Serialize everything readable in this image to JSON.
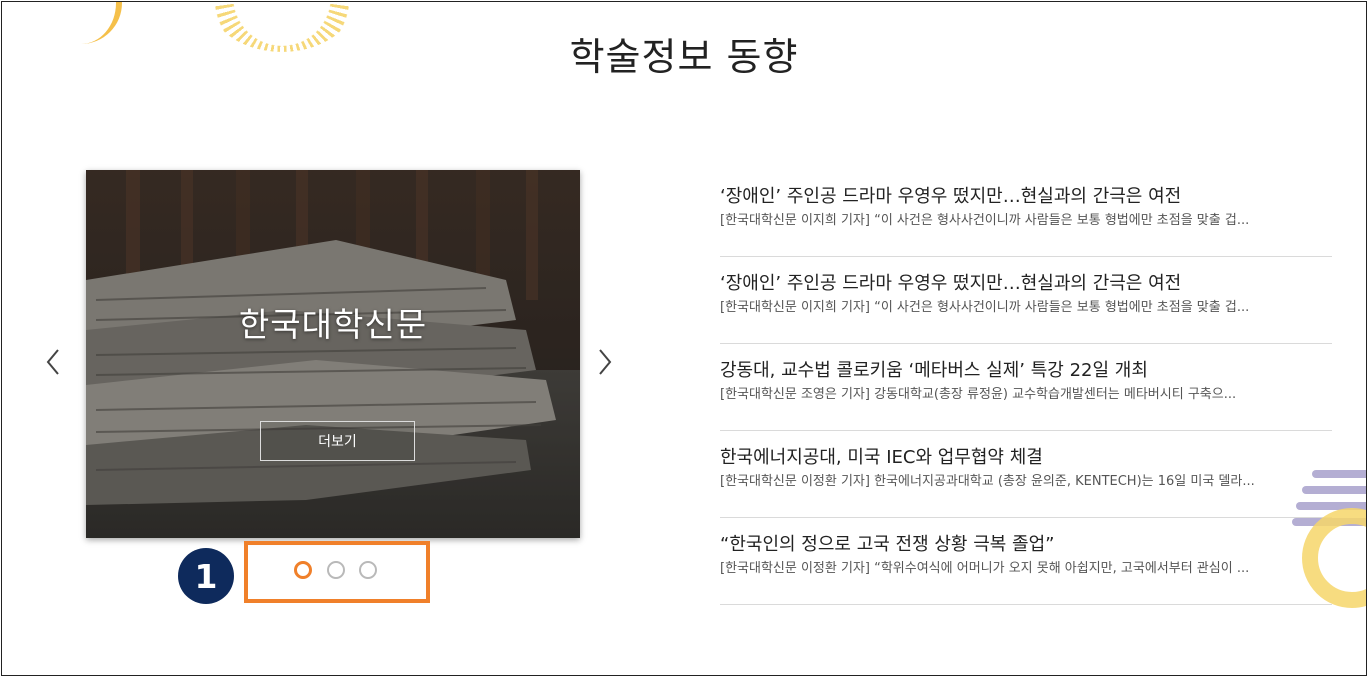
{
  "page": {
    "title": "학술정보 동향"
  },
  "slider": {
    "slide_title": "한국대학신문",
    "more_label": "더보기",
    "prev_icon": "chevron-left-icon",
    "next_icon": "chevron-right-icon",
    "dots": [
      {
        "active": true
      },
      {
        "active": false
      },
      {
        "active": false
      }
    ],
    "active_index": 0
  },
  "annotation": {
    "step_number": "1",
    "highlight_color": "#f0802a",
    "badge_color": "#0e2a5c"
  },
  "news": [
    {
      "title": "‘장애인’ 주인공 드라마 우영우 떴지만…현실과의 간극은 여전",
      "desc": "[한국대학신문 이지희 기자] “이 사건은 형사사건이니까 사람들은 보통 형법에만 초점을 맞출 겁..."
    },
    {
      "title": "‘장애인’ 주인공 드라마 우영우 떴지만…현실과의 간극은 여전",
      "desc": "[한국대학신문 이지희 기자] “이 사건은 형사사건이니까 사람들은 보통 형법에만 초점을 맞출 겁..."
    },
    {
      "title": "강동대, 교수법 콜로키움 ‘메타버스 실제’ 특강 22일 개최",
      "desc": "[한국대학신문 조영은 기자] 강동대학교(총장 류정윤) 교수학습개발센터는 메타버시티 구축으..."
    },
    {
      "title": "한국에너지공대, 미국 IEC와 업무협약 체결",
      "desc": "[한국대학신문 이정환 기자] 한국에너지공과대학교 (총장 윤의준, KENTECH)는 16일 미국 델라..."
    },
    {
      "title": "“한국인의 정으로 고국 전쟁 상황 극복 졸업”",
      "desc": "[한국대학신문 이정환 기자] “학위수여식에 어머니가 오지 못해 아쉽지만, 고국에서부터 관심이 ..."
    }
  ]
}
